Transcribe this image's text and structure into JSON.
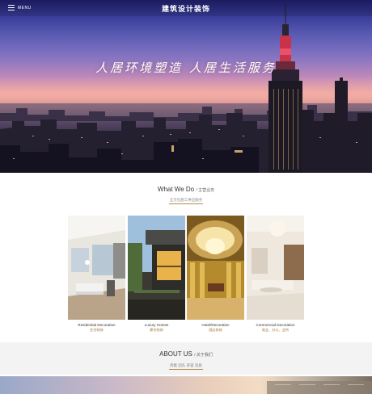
{
  "header": {
    "menu_label": "MENU",
    "logo_text": "建筑设计装饰",
    "slogan": "人居环境塑造 人居生活服务"
  },
  "what_we_do": {
    "title": "What We Do",
    "title_sub": "/ 主营业务",
    "subtitle": "全方位施工供应服务"
  },
  "services": [
    {
      "en": "Residential Decoration",
      "cn": "住宅装修"
    },
    {
      "en": "Luxury Homes",
      "cn": "豪宅装修"
    },
    {
      "en": "Hotel/Decoration",
      "cn": "酒店装修"
    },
    {
      "en": "Commercial Decoration",
      "cn": "商业、办公、会所"
    }
  ],
  "about": {
    "title": "ABOUT US",
    "title_sub": "/ 关于我们",
    "links": "简集 团队 荣誉 资质"
  },
  "colors": {
    "accent": "#b58b4c",
    "hero_sky_top": "#1f1f6e",
    "hero_sky_mid": "#e7a0a3"
  }
}
